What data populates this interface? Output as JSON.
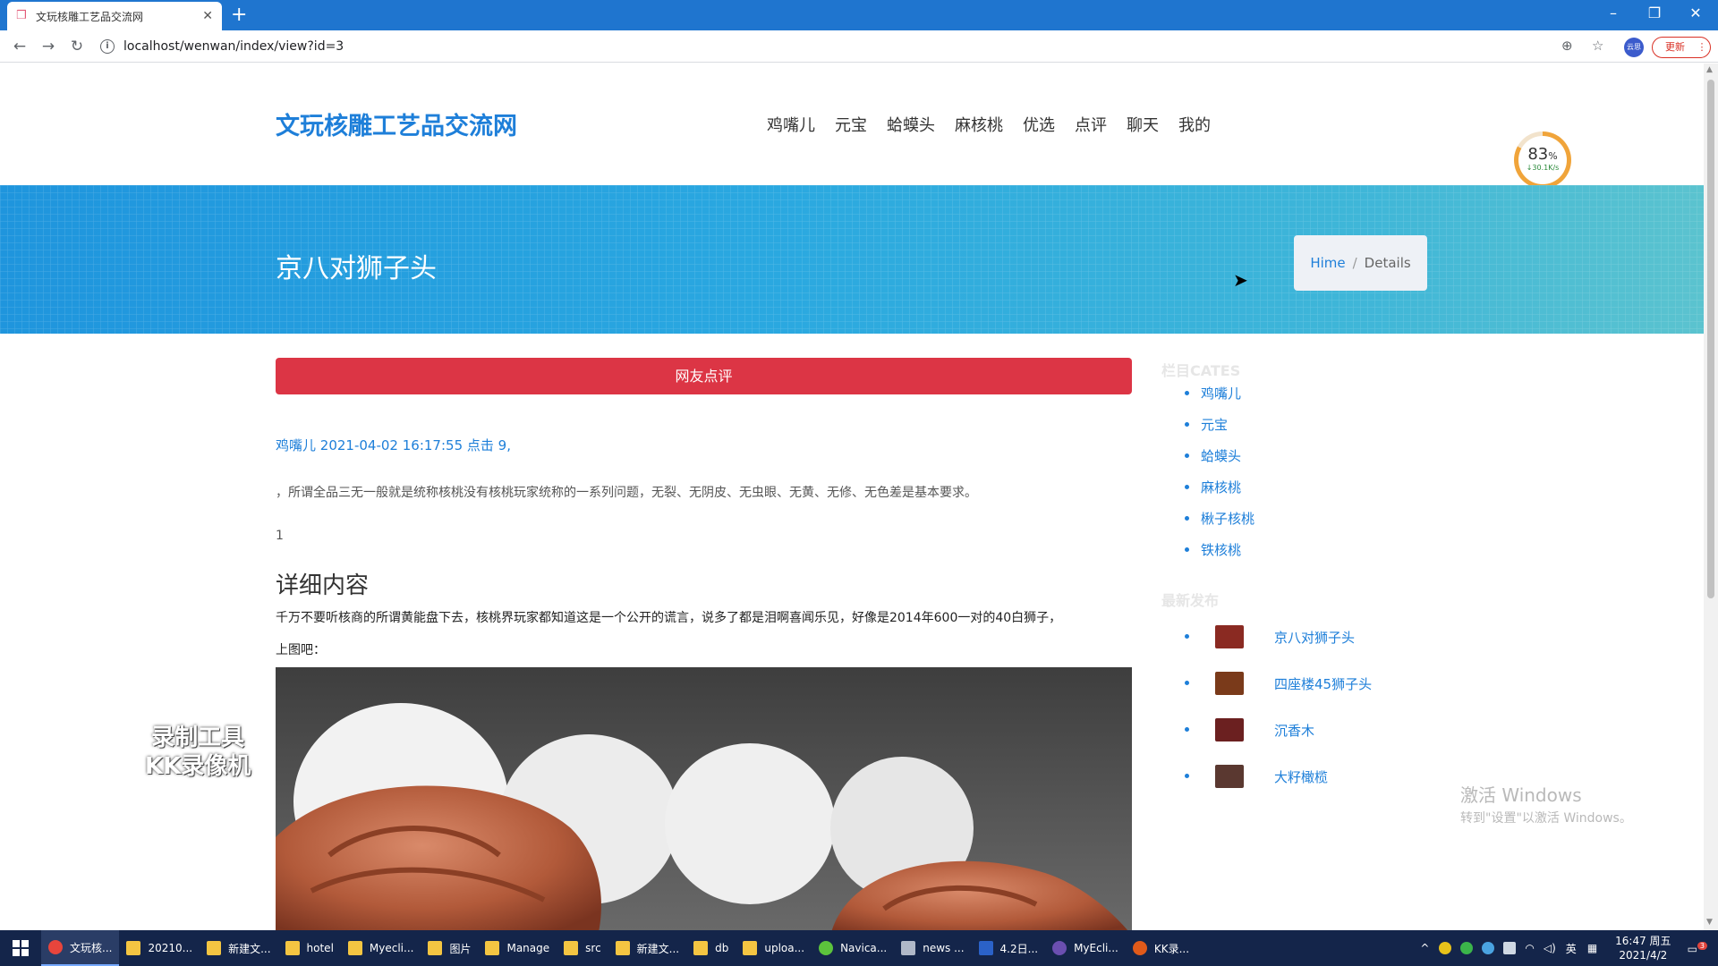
{
  "browser": {
    "tab_title": "文玩核雕工艺品交流网",
    "url": "localhost/wenwan/index/view?id=3",
    "update_label": "更新",
    "profile_label": "云思"
  },
  "site": {
    "logo": "文玩核雕工艺品交流网",
    "nav": [
      "鸡嘴儿",
      "元宝",
      "蛤蟆头",
      "麻核桃",
      "优选",
      "点评",
      "聊天",
      "我的"
    ]
  },
  "speed_widget": {
    "percent": "83",
    "percent_unit": "%",
    "rate": "↓30.1K/s"
  },
  "banner": {
    "title": "京八对狮子头",
    "breadcrumb_home": "Hime",
    "breadcrumb_sep": "/",
    "breadcrumb_current": "Details"
  },
  "article": {
    "comment_button": "网友点评",
    "meta_category": "鸡嘴儿",
    "meta_datetime": "2021-04-02 16:17:55",
    "meta_clicks": "点击 9,",
    "summary": "，所谓全品三无一般就是统称核桃没有核桃玩家统称的一系列问题，无裂、无阴皮、无虫眼、无黄、无修、无色差是基本要求。",
    "number": "1",
    "detail_heading": "详细内容",
    "paragraph1": "千万不要听核商的所谓黄能盘下去，核桃界玩家都知道这是一个公开的谎言，说多了都是泪啊喜闻乐见，好像是2014年600一对的40白狮子，",
    "paragraph2": "上图吧："
  },
  "sidebar": {
    "cates_heading": "栏目CATES",
    "categories": [
      "鸡嘴儿",
      "元宝",
      "蛤蟆头",
      "麻核桃",
      "楸子核桃",
      "铁核桃"
    ],
    "recent_heading": "最新发布",
    "recent": [
      {
        "label": "京八对狮子头",
        "thumb_color": "#8a2a22"
      },
      {
        "label": "四座楼45狮子头",
        "thumb_color": "#7a3a1a"
      },
      {
        "label": "沉香木",
        "thumb_color": "#6b2020"
      },
      {
        "label": "大籽橄榄",
        "thumb_color": "#5a3830"
      }
    ]
  },
  "overlay": {
    "recorder_line1": "录制工具",
    "recorder_line2": "KK录像机",
    "activate_title": "激活 Windows",
    "activate_sub": "转到\"设置\"以激活 Windows。"
  },
  "taskbar": {
    "items": [
      {
        "label": "文玩核...",
        "color": "#e8453c"
      },
      {
        "label": "20210...",
        "color": "#f4c542"
      },
      {
        "label": "新建文...",
        "color": "#f4c542"
      },
      {
        "label": "hotel",
        "color": "#f4c542"
      },
      {
        "label": "Myecli...",
        "color": "#f4c542"
      },
      {
        "label": "图片",
        "color": "#f4c542"
      },
      {
        "label": "Manage",
        "color": "#f4c542"
      },
      {
        "label": "src",
        "color": "#f4c542"
      },
      {
        "label": "新建文...",
        "color": "#f4c542"
      },
      {
        "label": "db",
        "color": "#f4c542"
      },
      {
        "label": "uploa...",
        "color": "#f4c542"
      },
      {
        "label": "Navica...",
        "color": "#5cc33c"
      },
      {
        "label": "news ...",
        "color": "#b0b8c8"
      },
      {
        "label": "4.2日...",
        "color": "#2b62c8"
      },
      {
        "label": "MyEcli...",
        "color": "#6b4fb0"
      },
      {
        "label": "KK录...",
        "color": "#e05a1a"
      }
    ],
    "ime": "英",
    "time": "16:47 周五",
    "date": "2021/4/2",
    "notification_count": "3"
  },
  "colors": {
    "accent": "#1e7fd9",
    "comment_button": "#dc3545",
    "banner_start": "#1f95dd",
    "banner_end": "#5bc3cf",
    "browser_bar": "#1f75cf",
    "taskbar": "#14254a"
  }
}
